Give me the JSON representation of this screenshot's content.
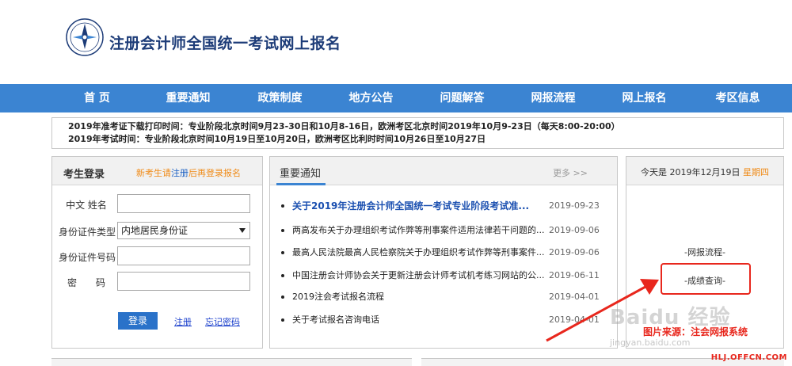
{
  "header": {
    "site_title": "注册会计师全国统一考试网上报名"
  },
  "nav": {
    "items": [
      {
        "label": "首 页"
      },
      {
        "label": "重要通知"
      },
      {
        "label": "政策制度"
      },
      {
        "label": "地方公告"
      },
      {
        "label": "问题解答"
      },
      {
        "label": "网报流程"
      },
      {
        "label": "网上报名"
      },
      {
        "label": "考区信息"
      }
    ]
  },
  "notice": {
    "line1": "2019年准考证下载打印时间：专业阶段北京时间9月23-30日和10月8-16日，欧洲考区北京时间2019年10月9-23日（每天8:00-20:00）",
    "line2": "2019年考试时间：专业阶段北京时间10月19日至10月20日，欧洲考区比利时时间10月26日至10月27日"
  },
  "login": {
    "title": "考生登录",
    "reg_tip_prefix": "新考生请",
    "reg_tip_link": "注册",
    "reg_tip_suffix": "后再登录报名",
    "name_label": "中文 姓名",
    "id_type_label": "身份证件类型",
    "id_type_value": "内地居民身份证",
    "id_number_label": "身份证件号码",
    "password_label": "密　　码",
    "name_value": "",
    "id_number_value": "",
    "password_value": "",
    "login_button": "登录",
    "register_link": "注册",
    "forgot_link": "忘记密码"
  },
  "news": {
    "tab_label": "重要通知",
    "more_label": "更多 >>",
    "items": [
      {
        "title": "关于2019年注册会计师全国统一考试专业阶段考试准...",
        "date": "2019-09-23"
      },
      {
        "title": "两高发布关于办理组织考试作弊等刑事案件适用法律若干问题的...",
        "date": "2019-09-06"
      },
      {
        "title": "最高人民法院最高人民检察院关于办理组织考试作弊等刑事案件...",
        "date": "2019-09-06"
      },
      {
        "title": "中国注册会计师协会关于更新注册会计师考试机考练习网站的公...",
        "date": "2019-06-11"
      },
      {
        "title": "2019注会考试报名流程",
        "date": "2019-04-01"
      },
      {
        "title": "关于考试报名咨询电话",
        "date": "2019-04-01"
      }
    ]
  },
  "side": {
    "today_prefix": "今天是 2019年12月19日",
    "weekday": "星期四",
    "link1": "-网报流程-",
    "link2": "-成绩查询-"
  },
  "overlay": {
    "watermark": "Baidu 经验",
    "watermark_sub": "jingyan.baidu.com",
    "caption": "图片来源：注会网报系统",
    "corner_tag": "HLJ.OFFCN.COM",
    "highlight_color": "#e8271d"
  },
  "colors": {
    "nav": "#3b84d2",
    "brand_title": "#1d3c78",
    "accent_orange": "#f08a16"
  }
}
